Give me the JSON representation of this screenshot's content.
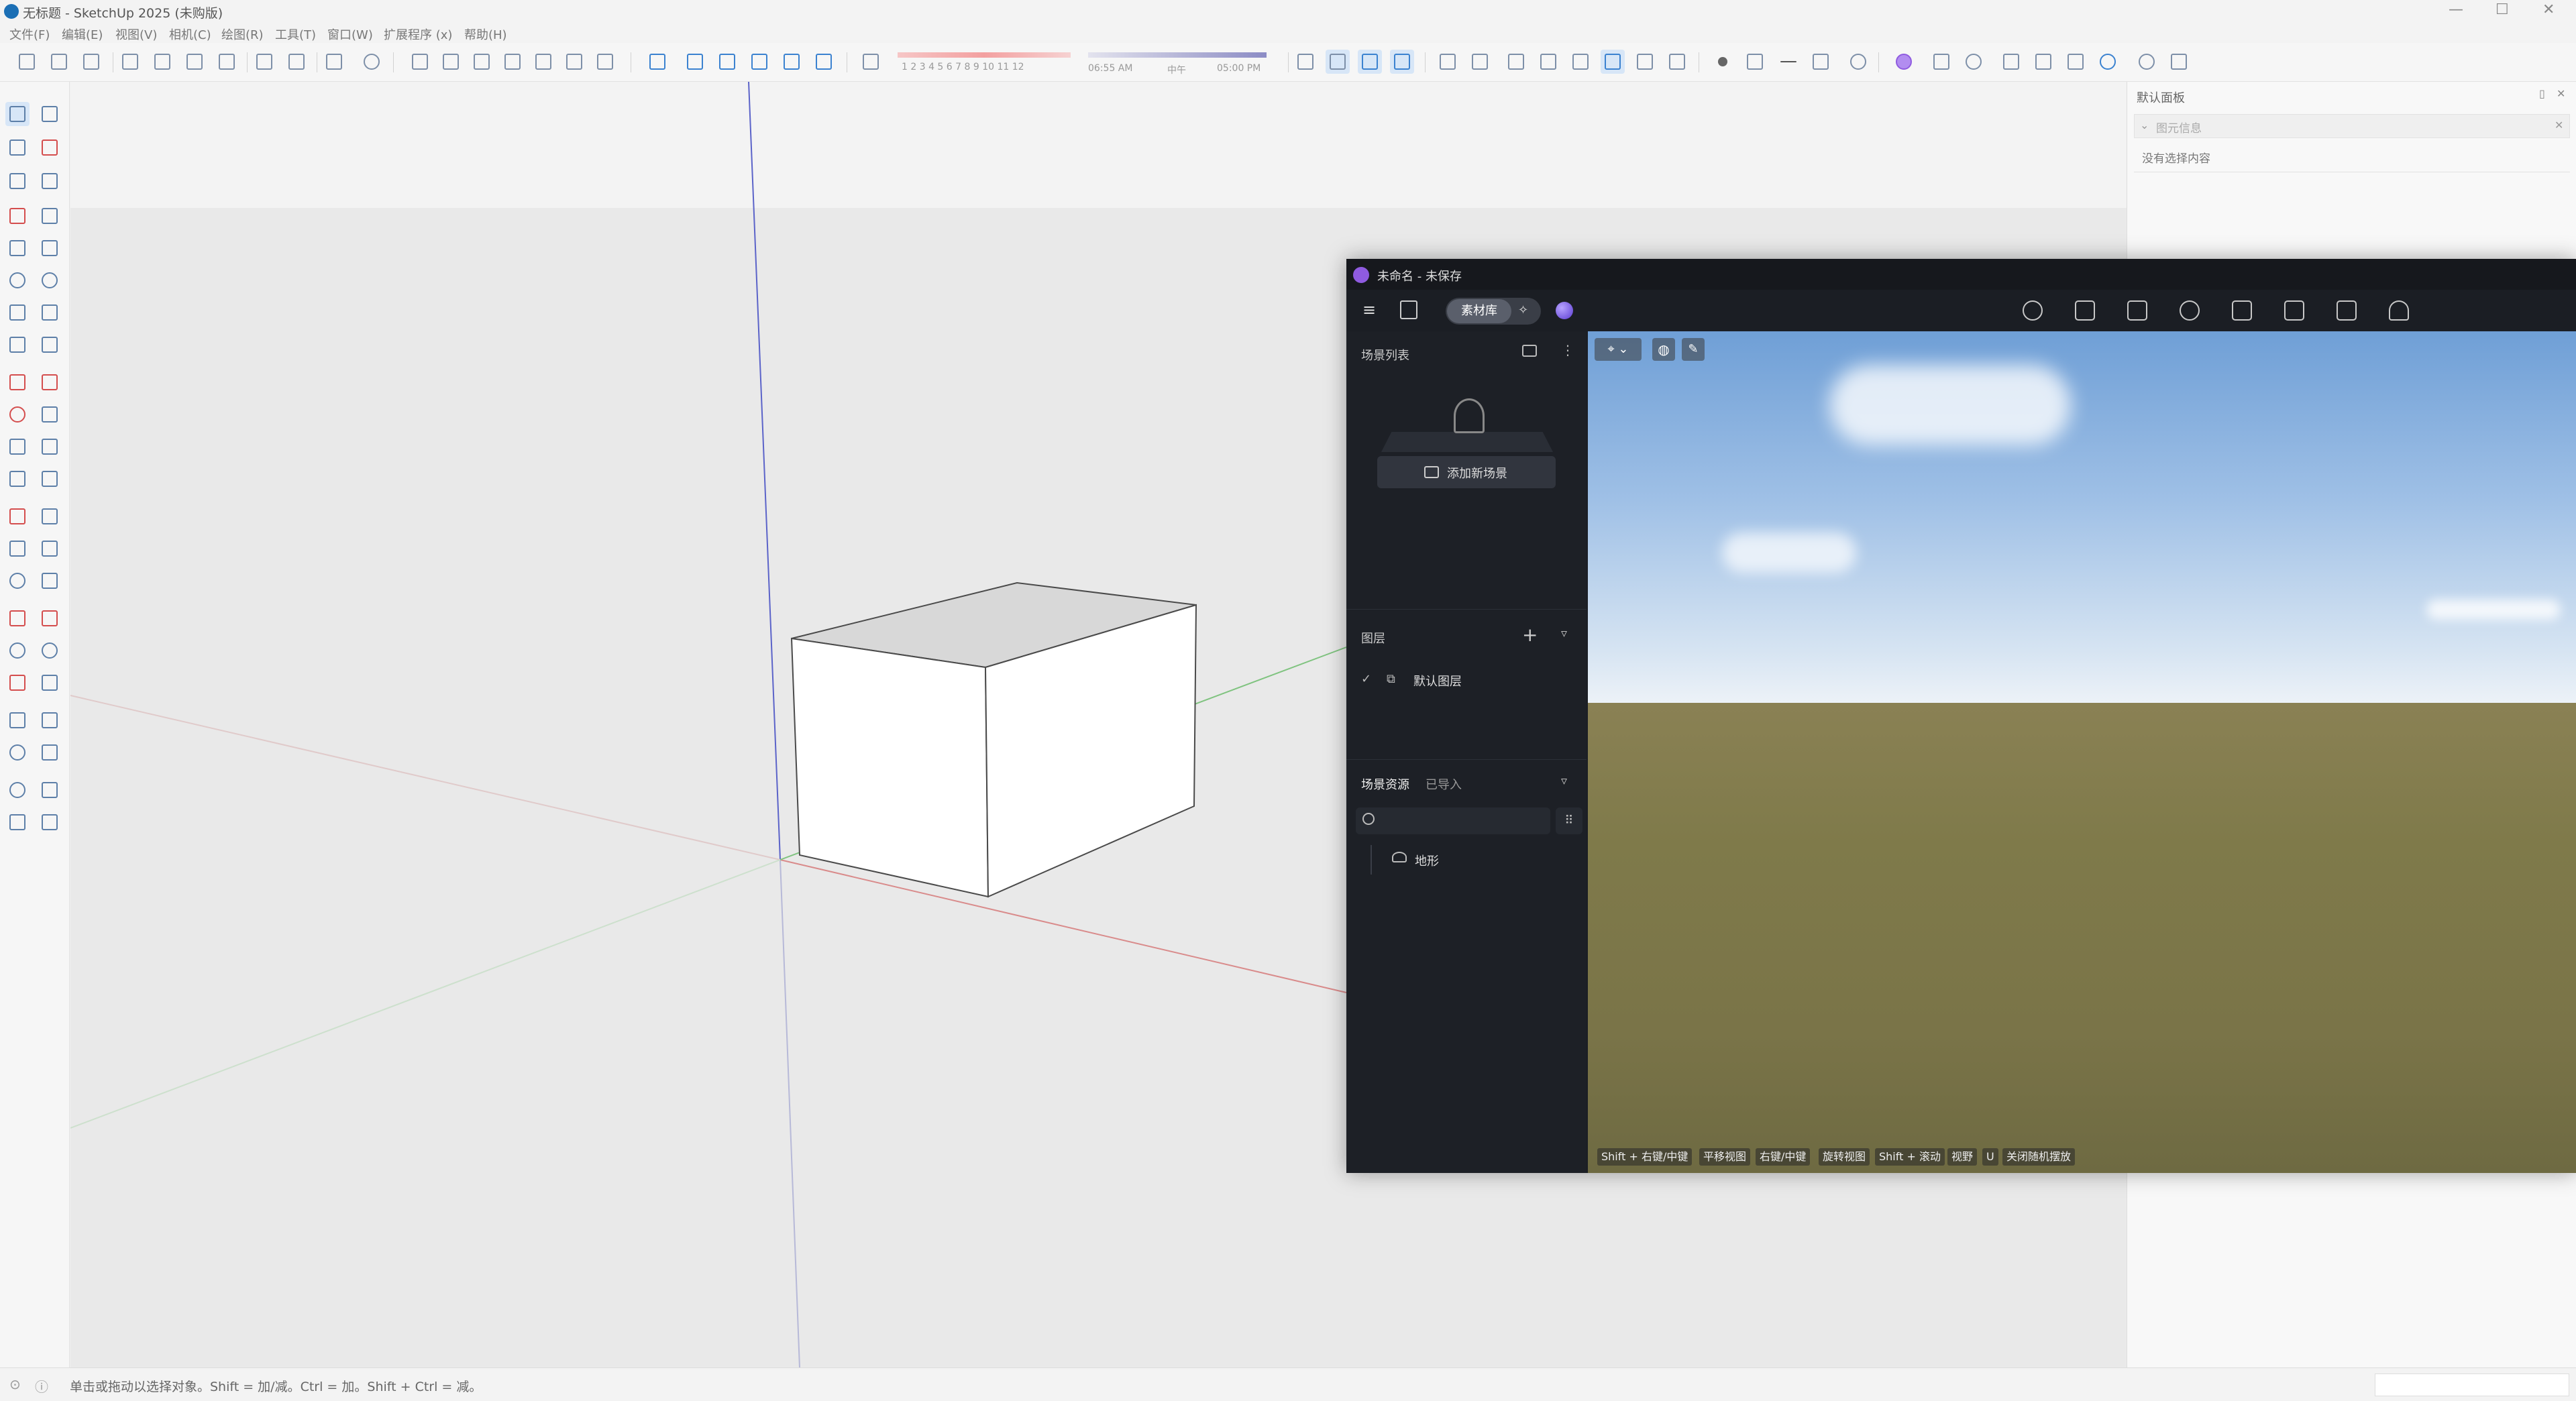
{
  "window": {
    "title": "无标题 - SketchUp 2025 (未购版)"
  },
  "menu": [
    "文件(F)",
    "编辑(E)",
    "视图(V)",
    "相机(C)",
    "绘图(R)",
    "工具(T)",
    "窗口(W)",
    "扩展程序 (x)",
    "帮助(H)"
  ],
  "toolbar": {
    "shadow_scale": "1  2  3  4  5  6  7  8  9  10  11  12",
    "time_start": "06:55 AM",
    "time_mid": "中午",
    "time_end": "05:00 PM"
  },
  "right_panel": {
    "title": "默认面板",
    "section": "图元信息",
    "empty_text": "没有选择内容"
  },
  "status": {
    "text": "单击或拖动以选择对象。Shift = 加/减。Ctrl = 加。Shift + Ctrl = 减。"
  },
  "overlay": {
    "title": "未命名 - 未保存",
    "assets_button": "素材库",
    "scene_list_label": "场景列表",
    "add_scene_button": "添加新场景",
    "layers_label": "图层",
    "default_layer": "默认图层",
    "scene_assets_tab": "场景资源",
    "imported_tab": "已导入",
    "terrain_item": "地形",
    "hints": [
      {
        "key": "Shift + 右键/中键",
        "action": "平移视图"
      },
      {
        "key": "右键/中键",
        "action": "旋转视图"
      },
      {
        "key": "Shift + 滚动",
        "action": "视野"
      },
      {
        "key": "U",
        "action": "关闭随机摆放"
      }
    ]
  },
  "colors": {
    "accent": "#3b82d0",
    "overlay_bg": "#1b1e24",
    "axis_blue": "#5b63c9",
    "axis_red": "#d98b8b",
    "axis_green": "#7fc37f"
  }
}
